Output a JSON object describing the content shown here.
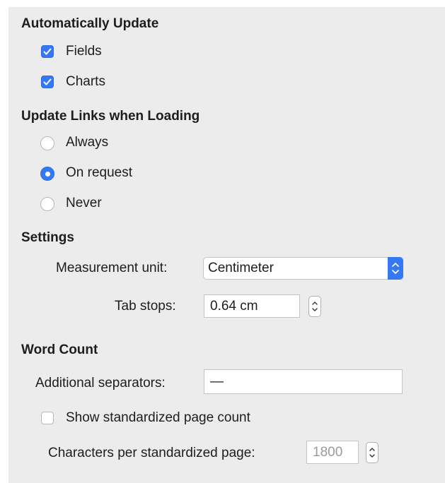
{
  "auto_update": {
    "heading": "Automatically Update",
    "fields_label": "Fields",
    "fields_checked": true,
    "charts_label": "Charts",
    "charts_checked": true
  },
  "update_links": {
    "heading": "Update Links when Loading",
    "options": [
      {
        "label": "Always",
        "selected": false
      },
      {
        "label": "On request",
        "selected": true
      },
      {
        "label": "Never",
        "selected": false
      }
    ]
  },
  "settings": {
    "heading": "Settings",
    "measurement_label": "Measurement unit:",
    "measurement_value": "Centimeter",
    "tab_stops_label": "Tab stops:",
    "tab_stops_value": "0.64 cm"
  },
  "word_count": {
    "heading": "Word Count",
    "separators_label": "Additional separators:",
    "separators_value": "—",
    "show_page_count_label": "Show standardized page count",
    "show_page_count_checked": false,
    "chars_per_page_label": "Characters per standardized page:",
    "chars_per_page_value": "1800"
  },
  "colors": {
    "accent": "#3478f6",
    "panel_bg": "#ececec"
  }
}
